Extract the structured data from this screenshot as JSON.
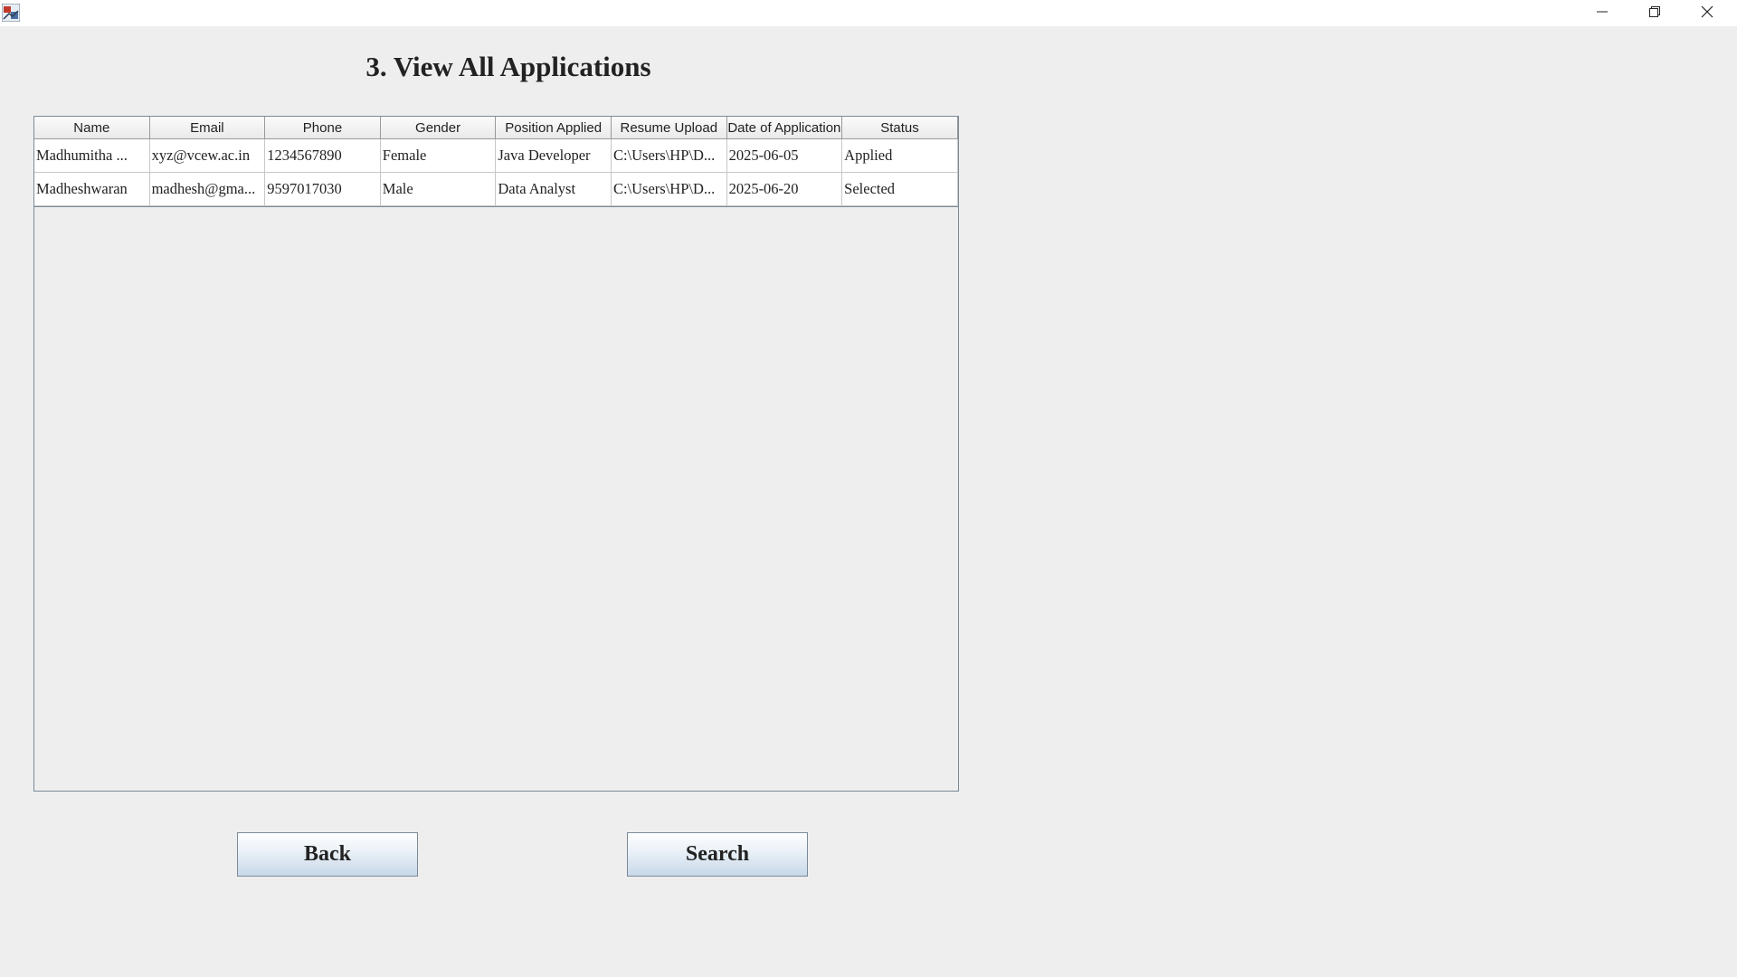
{
  "window": {
    "icons": {
      "app": "java-app-icon",
      "minimize": "minimize-icon",
      "maximize": "restore-icon",
      "close": "close-icon"
    }
  },
  "page": {
    "title": "3. View All Applications"
  },
  "table": {
    "columns": [
      "Name",
      "Email",
      "Phone",
      "Gender",
      "Position Applied",
      "Resume Upload",
      "Date of Application",
      "Status"
    ],
    "rows": [
      [
        "Madhumitha ...",
        "xyz@vcew.ac.in",
        "1234567890",
        "Female",
        "Java Developer",
        "C:\\Users\\HP\\D...",
        "2025-06-05",
        "Applied"
      ],
      [
        "Madheshwaran",
        "madhesh@gma...",
        "9597017030",
        "Male",
        "Data Analyst",
        "C:\\Users\\HP\\D...",
        "2025-06-20",
        "Selected"
      ]
    ]
  },
  "buttons": {
    "back": "Back",
    "search": "Search"
  }
}
